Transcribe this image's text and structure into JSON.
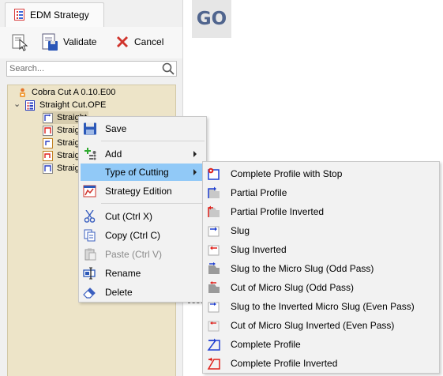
{
  "tab": {
    "label": "EDM Strategy"
  },
  "toolbar": {
    "validate_label": "Validate",
    "cancel_label": "Cancel"
  },
  "search": {
    "placeholder": "Search..."
  },
  "tree": {
    "root_label": "Cobra Cut A 0.10.E00",
    "operation_label": "Straight Cut.OPE",
    "toggle": "⌄",
    "children": [
      "Straight Cut Partial",
      "Straight Cut",
      "Straight Cut",
      "Straight Cut",
      "Straight Cut"
    ]
  },
  "go_button": {
    "label": "GO"
  },
  "context_menu": {
    "items": [
      {
        "label": "Save",
        "icon": "save-icon"
      },
      {
        "label": "Add",
        "icon": "add-icon",
        "submenu": true
      },
      {
        "label": "Type of Cutting",
        "icon": "none",
        "submenu": true,
        "highlighted": true
      },
      {
        "label": "Strategy Edition",
        "icon": "strategy-edition-icon"
      },
      {
        "label": "Cut (Ctrl X)",
        "icon": "scissors-icon"
      },
      {
        "label": "Copy (Ctrl C)",
        "icon": "copy-icon"
      },
      {
        "label": "Paste (Ctrl V)",
        "icon": "paste-icon",
        "disabled": true
      },
      {
        "label": "Rename",
        "icon": "rename-icon"
      },
      {
        "label": "Delete",
        "icon": "eraser-icon"
      }
    ]
  },
  "submenu": {
    "items": [
      {
        "label": "Complete Profile with Stop",
        "icon": "complete-profile-stop-icon"
      },
      {
        "label": "Partial Profile",
        "icon": "partial-profile-icon"
      },
      {
        "label": "Partial Profile Inverted",
        "icon": "partial-profile-inverted-icon"
      },
      {
        "label": "Slug",
        "icon": "slug-icon"
      },
      {
        "label": "Slug Inverted",
        "icon": "slug-inverted-icon"
      },
      {
        "label": "Slug to the Micro Slug (Odd Pass)",
        "icon": "slug-micro-odd-icon"
      },
      {
        "label": "Cut of Micro Slug (Odd Pass)",
        "icon": "cut-micro-odd-icon"
      },
      {
        "label": "Slug to the Inverted Micro Slug (Even Pass)",
        "icon": "slug-micro-even-icon"
      },
      {
        "label": "Cut of Micro Slug Inverted (Even Pass)",
        "icon": "cut-micro-even-icon"
      },
      {
        "label": "Complete Profile",
        "icon": "complete-profile-icon"
      },
      {
        "label": "Complete Profile Inverted",
        "icon": "complete-profile-inverted-icon"
      }
    ]
  },
  "colors": {
    "tree_background": "#ede4c8",
    "highlight": "#91c9f7",
    "go_text": "#50658e",
    "icon_blue": "#1f3fd1",
    "icon_red": "#e0201a"
  }
}
